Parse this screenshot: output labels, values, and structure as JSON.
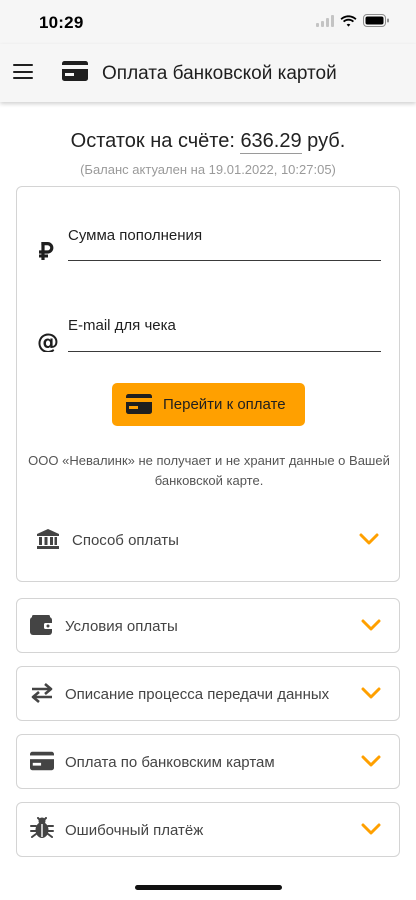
{
  "status_bar": {
    "time": "10:29"
  },
  "header": {
    "title": "Оплата банковской картой"
  },
  "balance": {
    "label": "Остаток на счёте:",
    "value": "636.29",
    "currency": "руб.",
    "note": "(Баланс актуален на 19.01.2022, 10:27:05)"
  },
  "form": {
    "amount_label": "Сумма пополнения",
    "email_label": "E-mail для чека",
    "pay_button": "Перейти к оплате",
    "disclaimer": "ООО «Невалинк» не получает и не хранит данные о Вашей банковской карте.",
    "payment_method": "Способ оплаты"
  },
  "sections": [
    {
      "label": "Условия оплаты",
      "icon": "wallet-icon"
    },
    {
      "label": "Описание процесса передачи данных",
      "icon": "swap-arrows-icon"
    },
    {
      "label": "Оплата по банковским картам",
      "icon": "credit-card-icon"
    },
    {
      "label": "Ошибочный платёж",
      "icon": "bug-icon"
    }
  ],
  "colors": {
    "accent": "#ffa000",
    "app_bar": "#f6f6f6",
    "border": "#d4d4d4",
    "muted": "#9a9a9a"
  }
}
